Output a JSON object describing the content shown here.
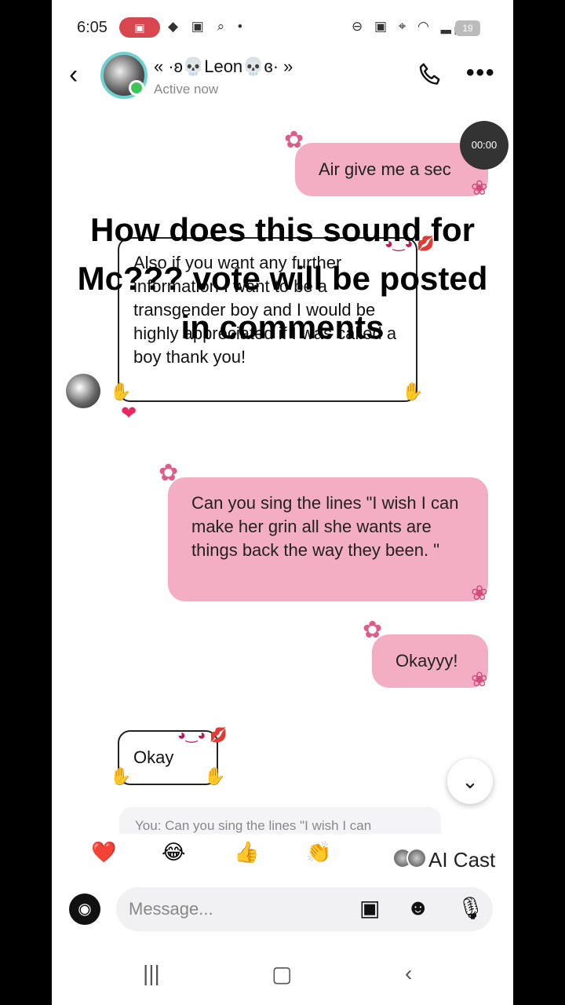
{
  "status_bar": {
    "time": "6:05",
    "battery": "19",
    "icons": [
      "cast-icon",
      "signal-icon",
      "wifi-icon",
      "location-icon",
      "dnd-icon"
    ]
  },
  "header": {
    "contact_name": "« ·ʚ💀Leon💀ɞ· »",
    "contact_status": "Active now",
    "back_icon": "‹",
    "more_icon": "•••"
  },
  "voice_timer": "00:00",
  "overlay_caption": "How does this sound for Mc??? vote will be posted in comments",
  "messages": [
    {
      "direction": "sent",
      "text": "Air give me a sec"
    },
    {
      "direction": "received",
      "text": "Also if you want any further information I want to be a transgender boy and I would be highly appreciated if I was called a boy thank you!",
      "reaction": "❤"
    },
    {
      "direction": "sent",
      "text": "Can you sing the lines \"I wish I can make her grin all she wants are things back the way they been. \""
    },
    {
      "direction": "sent",
      "text": "Okayyy!"
    },
    {
      "direction": "received",
      "text": "Okay"
    }
  ],
  "reply_preview": "You: Can you sing the lines \"I wish I can",
  "reactions": {
    "emojis": [
      "❤️",
      "😂",
      "👍",
      "👏"
    ],
    "ai_cast_label": "AI Cast"
  },
  "composer": {
    "placeholder": "Message..."
  },
  "nav": {
    "recents": "|||",
    "home": "▢",
    "back": "‹"
  },
  "colors": {
    "sent_bubble": "#f4aec4",
    "accent_pink": "#e05a8a",
    "online": "#3ec55a"
  }
}
